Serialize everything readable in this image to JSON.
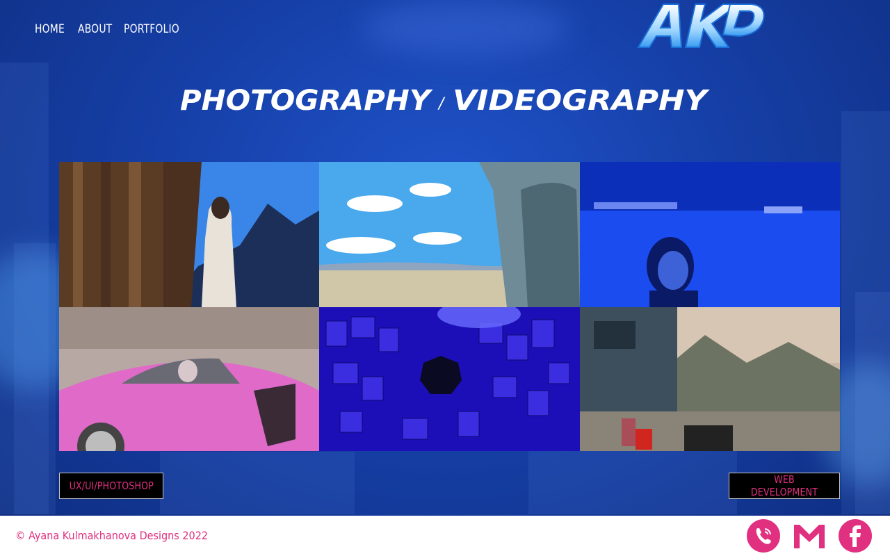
{
  "nav": {
    "items": [
      {
        "label": "HOME"
      },
      {
        "label": "ABOUT"
      },
      {
        "label": "PORTFOLIO"
      }
    ]
  },
  "logo": {
    "text": "AKD"
  },
  "heading": {
    "part1": "PHOTOGRAPHY",
    "separator": "/",
    "part2": "VIDEOGRAPHY"
  },
  "gallery": {
    "photos": [
      {
        "icon": "photo-woman-at-window-curtain"
      },
      {
        "icon": "photo-car-window-sky"
      },
      {
        "icon": "photo-girl-on-beach-blue"
      },
      {
        "icon": "photo-pink-sports-car"
      },
      {
        "icon": "photo-poster-wall-blue-light"
      },
      {
        "icon": "photo-mountain-cafe-sunset"
      }
    ]
  },
  "buttons": {
    "left": "UX/UI/PHOTOSHOP",
    "right": "WEB DEVELOPMENT"
  },
  "footer": {
    "copyright": "© Ayana Kulmakhanova Designs 2022"
  },
  "social": [
    {
      "icon": "phone-icon"
    },
    {
      "icon": "gmail-icon"
    },
    {
      "icon": "facebook-icon"
    }
  ],
  "colors": {
    "accent": "#e0307f",
    "bg_blue": "#1a46b4",
    "button_bg": "#000000",
    "footer_bg": "#ffffff"
  }
}
